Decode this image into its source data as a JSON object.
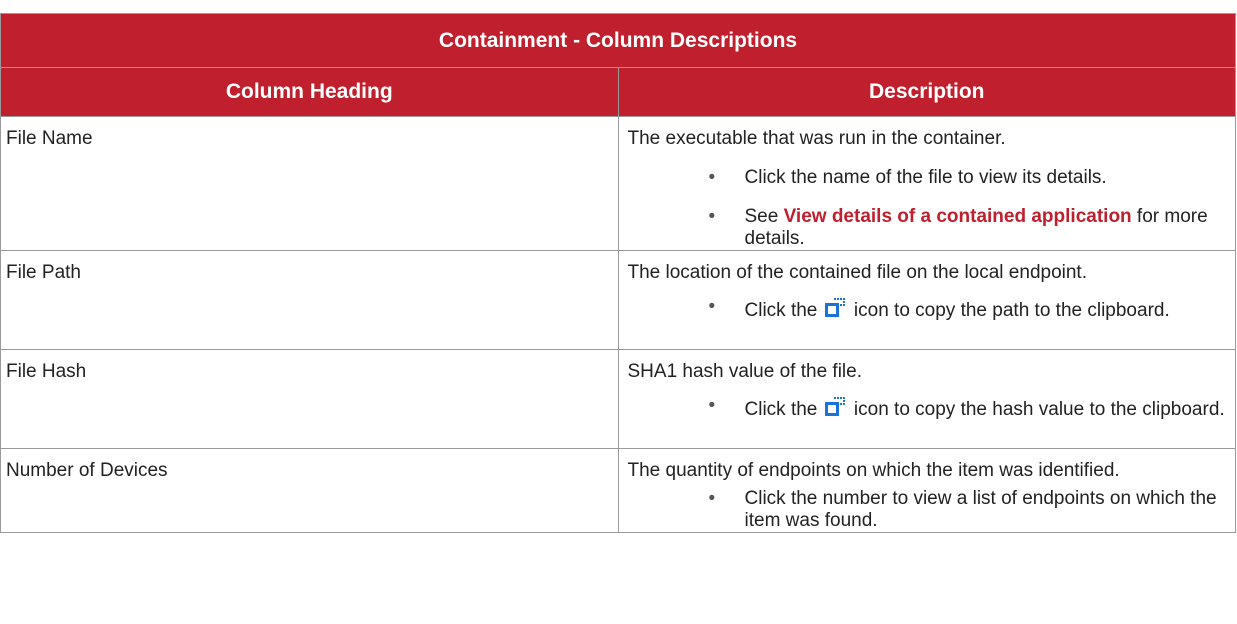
{
  "table": {
    "title": "Containment - Column Descriptions",
    "headers": {
      "col1": "Column Heading",
      "col2": "Description"
    },
    "rows": [
      {
        "heading": "File Name",
        "description": "The executable that was run in the container.",
        "bullets": [
          {
            "text": "Click the name of the file to view its details."
          },
          {
            "pre": "See ",
            "link": "View details of a contained application",
            "post": " for more details."
          }
        ]
      },
      {
        "heading": "File Path",
        "description": "The location of the contained file on the local endpoint.",
        "bullets": [
          {
            "pre": "Click the ",
            "icon": "copy-icon",
            "post": " icon to copy the path to the clipboard."
          }
        ]
      },
      {
        "heading": "File Hash",
        "description": "SHA1 hash value of the file.",
        "bullets": [
          {
            "pre": "Click the ",
            "icon": "copy-icon",
            "post": " icon to copy the hash value to the clipboard."
          }
        ]
      },
      {
        "heading": "Number of Devices",
        "description": "The quantity of endpoints on which the item was identified.",
        "bullets": [
          {
            "text": "Click the number to view a list of endpoints on which the item was found."
          }
        ]
      }
    ],
    "bullet_char": "•"
  },
  "colors": {
    "header_bg": "#c0202e",
    "link": "#c0202e",
    "icon_blue": "#1a73d9"
  }
}
